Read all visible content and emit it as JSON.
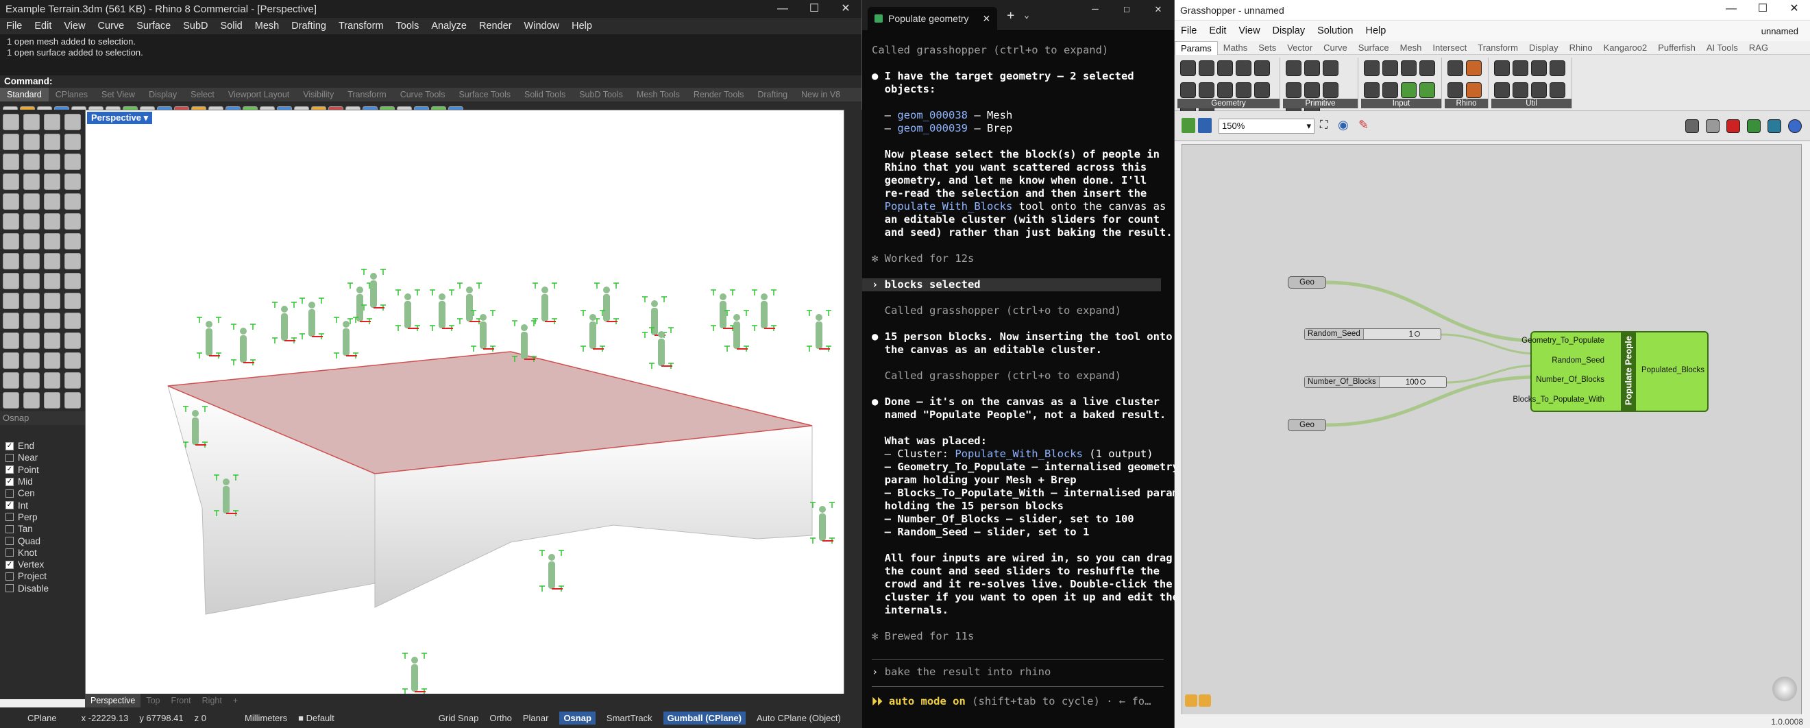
{
  "rhino": {
    "title": "Example Terrain.3dm (561 KB) - Rhino 8 Commercial - [Perspective]",
    "menu": [
      "File",
      "Edit",
      "View",
      "Curve",
      "Surface",
      "SubD",
      "Solid",
      "Mesh",
      "Drafting",
      "Transform",
      "Tools",
      "Analyze",
      "Render",
      "Window",
      "Help"
    ],
    "history": [
      "1 open mesh added to selection.",
      "1 open surface added to selection."
    ],
    "command_label": "Command:",
    "toolbar_tabs": [
      "Standard",
      "CPlanes",
      "Set View",
      "Display",
      "Select",
      "Viewport Layout",
      "Visibility",
      "Transform",
      "Curve Tools",
      "Surface Tools",
      "Solid Tools",
      "SubD Tools",
      "Mesh Tools",
      "Render Tools",
      "Drafting",
      "New in V8"
    ],
    "viewport_name": "Perspective",
    "osnap_header": "Osnap",
    "osnaps": [
      {
        "label": "End",
        "on": true
      },
      {
        "label": "Near",
        "on": false
      },
      {
        "label": "Point",
        "on": true
      },
      {
        "label": "Mid",
        "on": true
      },
      {
        "label": "Cen",
        "on": false
      },
      {
        "label": "Int",
        "on": true
      },
      {
        "label": "Perp",
        "on": false
      },
      {
        "label": "Tan",
        "on": false
      },
      {
        "label": "Quad",
        "on": false
      },
      {
        "label": "Knot",
        "on": false
      },
      {
        "label": "Vertex",
        "on": true
      },
      {
        "label": "Project",
        "on": false
      },
      {
        "label": "Disable",
        "on": false
      }
    ],
    "view_tabs": [
      "Perspective",
      "Top",
      "Front",
      "Right",
      "+"
    ],
    "status": {
      "cplane": "CPlane",
      "x": "x -22229.13",
      "y": "y 67798.41",
      "z": "z 0",
      "units": "Millimeters",
      "layer": "Default",
      "grid_snap": "Grid Snap",
      "ortho": "Ortho",
      "planar": "Planar",
      "osnap": "Osnap",
      "smarttrack": "SmartTrack",
      "gumball": "Gumball (CPlane)",
      "autocplane": "Auto CPlane (Object)"
    }
  },
  "terminal": {
    "tab_title": "Populate geometry",
    "lines": [
      {
        "t": "Called grasshopper (ctrl+o to expand)",
        "c": "dim"
      },
      {
        "t": "",
        "c": ""
      },
      {
        "t": "● I have the target geometry — 2 selected",
        "c": "wht"
      },
      {
        "t": "  objects:",
        "c": "wht"
      },
      {
        "t": "",
        "c": ""
      },
      {
        "t": "  – geom_000038 – Mesh",
        "c": "mix1"
      },
      {
        "t": "  – geom_000039 – Brep",
        "c": "mix2"
      },
      {
        "t": "",
        "c": ""
      },
      {
        "t": "  Now please select the block(s) of people in",
        "c": "wht"
      },
      {
        "t": "  Rhino that you want scattered across this",
        "c": "wht"
      },
      {
        "t": "  geometry, and let me know when done. I'll",
        "c": "wht"
      },
      {
        "t": "  re-read the selection and then insert the",
        "c": "wht"
      },
      {
        "t": "  Populate_With_Blocks tool onto the canvas as",
        "c": "mix3"
      },
      {
        "t": "  an editable cluster (with sliders for count",
        "c": "wht"
      },
      {
        "t": "  and seed) rather than just baking the result.",
        "c": "wht"
      },
      {
        "t": "",
        "c": ""
      },
      {
        "t": "✻ Worked for 12s",
        "c": "dim"
      },
      {
        "t": "",
        "c": ""
      },
      {
        "t": "› blocks selected",
        "c": "sel"
      },
      {
        "t": "",
        "c": ""
      },
      {
        "t": "  Called grasshopper (ctrl+o to expand)",
        "c": "dim"
      },
      {
        "t": "",
        "c": ""
      },
      {
        "t": "● 15 person blocks. Now inserting the tool onto",
        "c": "wht"
      },
      {
        "t": "  the canvas as an editable cluster.",
        "c": "wht"
      },
      {
        "t": "",
        "c": ""
      },
      {
        "t": "  Called grasshopper (ctrl+o to expand)",
        "c": "dim"
      },
      {
        "t": "",
        "c": ""
      },
      {
        "t": "● Done — it's on the canvas as a live cluster",
        "c": "wht"
      },
      {
        "t": "  named \"Populate People\", not a baked result.",
        "c": "wht"
      },
      {
        "t": "",
        "c": ""
      },
      {
        "t": "  What was placed:",
        "c": "wht"
      },
      {
        "t": "  – Cluster: Populate_With_Blocks (1 output)",
        "c": "mix4"
      },
      {
        "t": "  – Geometry_To_Populate – internalised geometry",
        "c": "wht"
      },
      {
        "t": "  param holding your Mesh + Brep",
        "c": "wht"
      },
      {
        "t": "  – Blocks_To_Populate_With – internalised param",
        "c": "wht"
      },
      {
        "t": "  holding the 15 person blocks",
        "c": "wht"
      },
      {
        "t": "  – Number_Of_Blocks – slider, set to 100",
        "c": "wht"
      },
      {
        "t": "  – Random_Seed – slider, set to 1",
        "c": "wht"
      },
      {
        "t": "",
        "c": ""
      },
      {
        "t": "  All four inputs are wired in, so you can drag",
        "c": "wht"
      },
      {
        "t": "  the count and seed sliders to reshuffle the",
        "c": "wht"
      },
      {
        "t": "  crowd and it re-solves live. Double-click the",
        "c": "wht"
      },
      {
        "t": "  cluster if you want to open it up and edit the",
        "c": "wht"
      },
      {
        "t": "  internals.",
        "c": "wht"
      },
      {
        "t": "",
        "c": ""
      },
      {
        "t": "✻ Brewed for 11s",
        "c": "dim"
      }
    ],
    "prompt_text": "bake the result into rhino",
    "mode_text": "auto mode on",
    "mode_hint": "(shift+tab to cycle) · ← fo…"
  },
  "grasshopper": {
    "title": "Grasshopper - unnamed",
    "doc_name": "unnamed",
    "menu": [
      "File",
      "Edit",
      "View",
      "Display",
      "Solution",
      "Help"
    ],
    "tabs": [
      "Params",
      "Maths",
      "Sets",
      "Vector",
      "Curve",
      "Surface",
      "Mesh",
      "Intersect",
      "Transform",
      "Display",
      "Rhino",
      "Kangaroo2",
      "Pufferfish",
      "AI Tools",
      "RAG"
    ],
    "groups": [
      "Geometry",
      "Primitive",
      "Input",
      "Rhino",
      "Util"
    ],
    "zoom": "150%",
    "geo1": "Geo",
    "geo2": "Geo",
    "seed_slider": {
      "name": "Random_Seed",
      "value": "1"
    },
    "count_slider": {
      "name": "Number_Of_Blocks",
      "value": "100"
    },
    "cluster_title": "Populate People",
    "inputs": [
      "Geometry_To_Populate",
      "Random_Seed",
      "Number_Of_Blocks",
      "Blocks_To_Populate_With"
    ],
    "output": "Populated_Blocks",
    "version": "1.0.0008"
  }
}
